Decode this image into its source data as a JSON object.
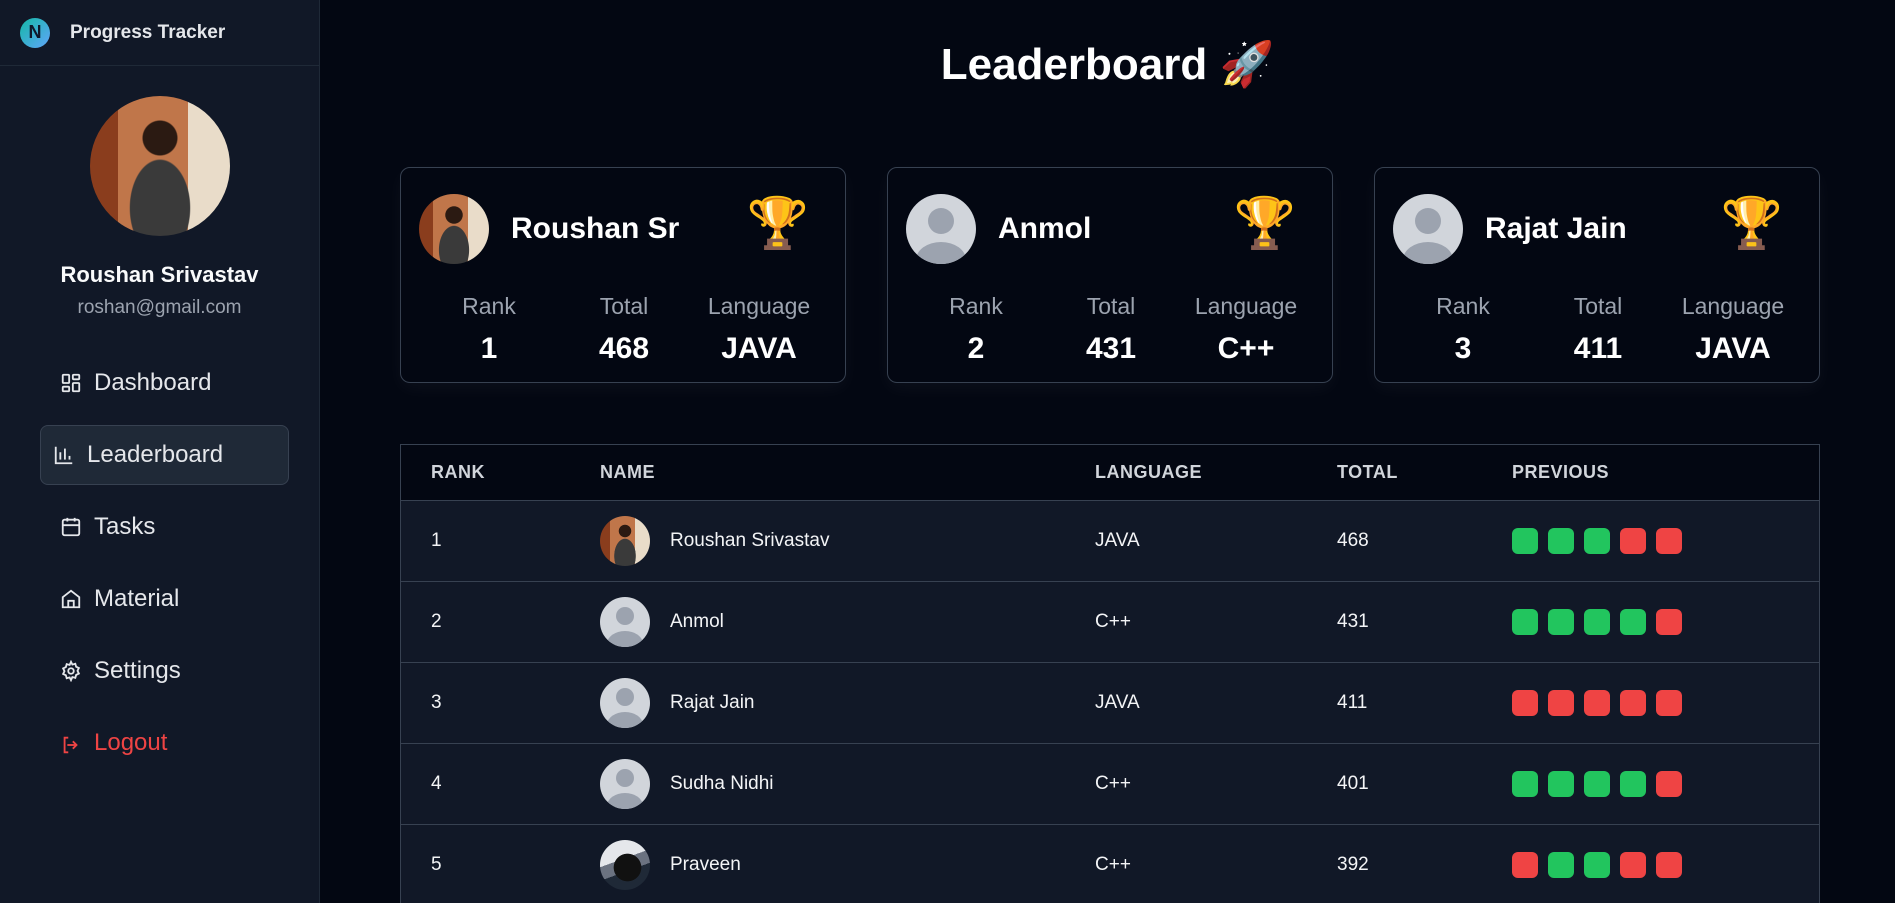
{
  "brand": {
    "title": "Progress Tracker",
    "logo_letter": "N"
  },
  "profile": {
    "name": "Roushan Srivastav",
    "email": "roshan@gmail.com"
  },
  "nav": [
    {
      "label": "Dashboard",
      "icon": "dashboard-icon"
    },
    {
      "label": "Leaderboard",
      "icon": "bar-chart-icon",
      "active": true
    },
    {
      "label": "Tasks",
      "icon": "calendar-icon"
    },
    {
      "label": "Material",
      "icon": "home-icon"
    },
    {
      "label": "Settings",
      "icon": "gear-icon"
    },
    {
      "label": "Logout",
      "icon": "logout-icon"
    }
  ],
  "page": {
    "title": "Leaderboard",
    "title_emoji": "🚀"
  },
  "top_cards": [
    {
      "name": "Roushan Sri",
      "trophy": "🏆",
      "rank_label": "Rank",
      "rank": "1",
      "total_label": "Total",
      "total": "468",
      "lang_label": "Language",
      "language": "JAVA"
    },
    {
      "name": "Anmol",
      "trophy": "🏆",
      "rank_label": "Rank",
      "rank": "2",
      "total_label": "Total",
      "total": "431",
      "lang_label": "Language",
      "language": "C++"
    },
    {
      "name": "Rajat Jain",
      "trophy": "🏆",
      "rank_label": "Rank",
      "rank": "3",
      "total_label": "Total",
      "total": "411",
      "lang_label": "Language",
      "language": "JAVA"
    }
  ],
  "table": {
    "headers": {
      "rank": "RANK",
      "name": "NAME",
      "language": "LANGUAGE",
      "total": "TOTAL",
      "previous": "PREVIOUS"
    },
    "rows": [
      {
        "rank": "1",
        "name": "Roushan Srivastav",
        "language": "JAVA",
        "total": "468",
        "previous": [
          "pass",
          "pass",
          "pass",
          "fail",
          "fail"
        ]
      },
      {
        "rank": "2",
        "name": "Anmol",
        "language": "C++",
        "total": "431",
        "previous": [
          "pass",
          "pass",
          "pass",
          "pass",
          "fail"
        ]
      },
      {
        "rank": "3",
        "name": "Rajat Jain",
        "language": "JAVA",
        "total": "411",
        "previous": [
          "fail",
          "fail",
          "fail",
          "fail",
          "fail"
        ]
      },
      {
        "rank": "4",
        "name": "Sudha Nidhi",
        "language": "C++",
        "total": "401",
        "previous": [
          "pass",
          "pass",
          "pass",
          "pass",
          "fail"
        ]
      },
      {
        "rank": "5",
        "name": "Praveen",
        "language": "C++",
        "total": "392",
        "previous": [
          "fail",
          "pass",
          "pass",
          "fail",
          "fail"
        ]
      }
    ]
  },
  "colors": {
    "pass": "#22c55e",
    "fail": "#ef4444",
    "logout": "#ef4444"
  }
}
